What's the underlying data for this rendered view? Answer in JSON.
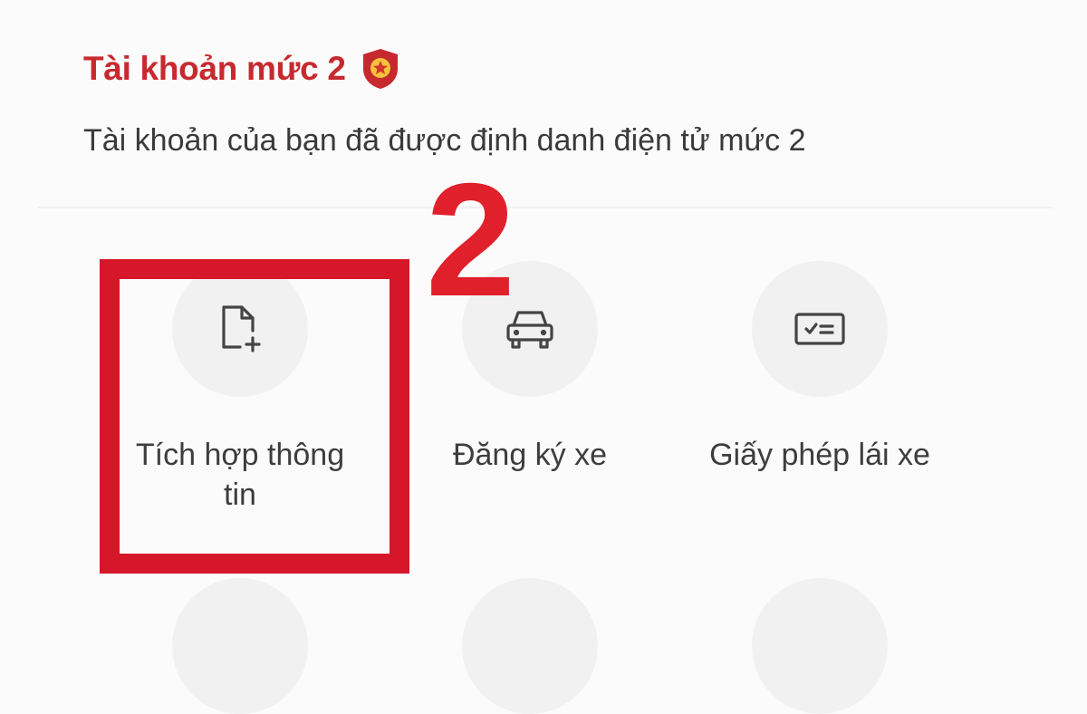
{
  "account": {
    "level_title": "Tài khoản mức 2",
    "description": "Tài khoản của bạn đã được định danh điện tử mức 2",
    "badge_icon": "shield-star-icon",
    "badge_color": "#c62a2f"
  },
  "annotation": {
    "step_number": "2",
    "color": "#d6172a"
  },
  "services": [
    {
      "label": "Tích hợp thông tin",
      "icon": "document-add-icon"
    },
    {
      "label": "Đăng ký xe",
      "icon": "car-icon"
    },
    {
      "label": "Giấy phép lái xe",
      "icon": "license-card-icon"
    }
  ]
}
